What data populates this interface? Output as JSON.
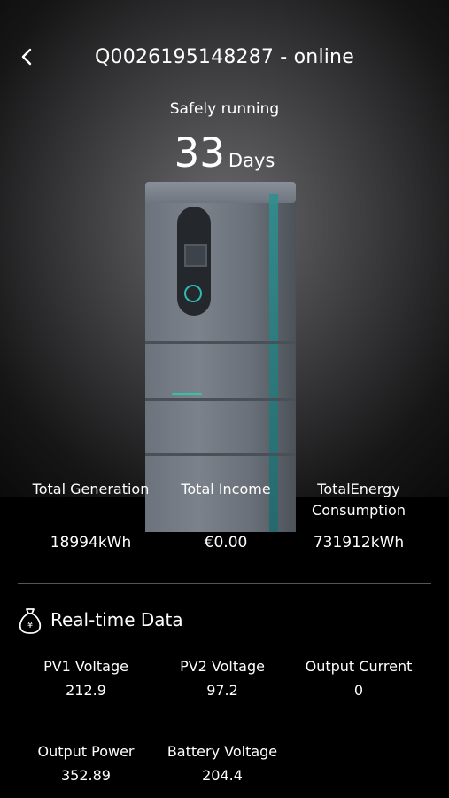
{
  "header": {
    "title": "Q0026195148287 - online"
  },
  "status": {
    "label": "Safely running",
    "days_value": "33",
    "days_unit": "Days"
  },
  "summary": [
    {
      "label": "Total Generation",
      "value": "18994kWh"
    },
    {
      "label": "Total Income",
      "value": "€0.00"
    },
    {
      "label_line1": "TotalEnergy",
      "label_line2": "Consumption",
      "value": "731912kWh"
    }
  ],
  "realtime": {
    "title": "Real-time Data",
    "metrics": [
      {
        "label": "PV1 Voltage",
        "value": "212.9"
      },
      {
        "label": "PV2 Voltage",
        "value": "97.2"
      },
      {
        "label": "Output Current",
        "value": "0"
      },
      {
        "label": "Output Power",
        "value": "352.89"
      },
      {
        "label": "Battery Voltage",
        "value": "204.4"
      }
    ]
  },
  "colors": {
    "accent_teal": "#2fb9b5",
    "background_dark": "#000000"
  },
  "icons": {
    "back": "chevron-left-icon",
    "realtime": "money-bag-icon"
  }
}
